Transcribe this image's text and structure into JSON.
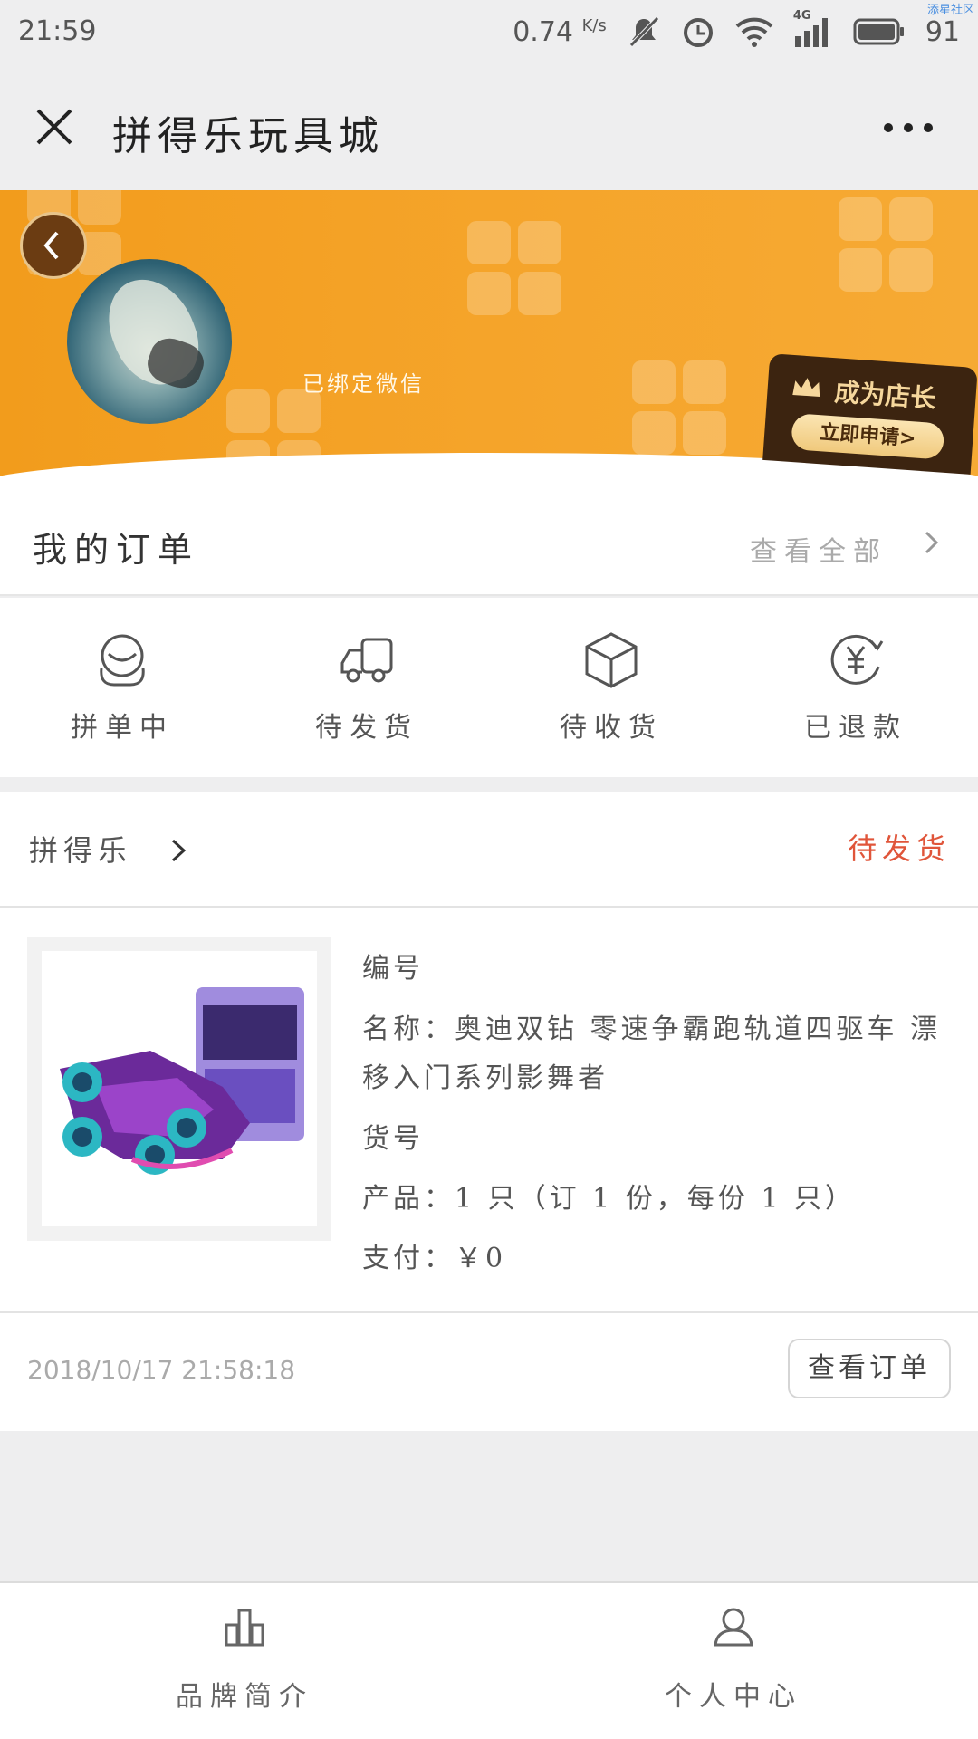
{
  "status_bar": {
    "time": "21:59",
    "net_speed": "0.74",
    "net_unit": "K/s",
    "network": "4G",
    "battery": "91",
    "watermark": "添星社区"
  },
  "nav": {
    "title": "拼得乐玩具城"
  },
  "profile": {
    "bound_text": "已绑定微信",
    "shop_owner_title": "成为店长",
    "shop_owner_apply": "立即申请>"
  },
  "orders": {
    "title": "我的订单",
    "view_all": "查看全部",
    "categories": [
      {
        "label": "拼单中",
        "icon": "group-person-icon"
      },
      {
        "label": "待发货",
        "icon": "delivery-truck-icon"
      },
      {
        "label": "待收货",
        "icon": "package-box-icon"
      },
      {
        "label": "已退款",
        "icon": "yen-refund-icon"
      }
    ]
  },
  "order": {
    "shop_name": "拼得乐",
    "status": "待发货",
    "number_label": "编号",
    "name_text": "名称：奥迪双钻 零速争霸跑轨道四驱车 漂移入门系列影舞者",
    "sku_label": "货号",
    "product_text": "产品：1 只（订 1 份，每份 1 只）",
    "payment_text": "支付：￥0",
    "date": "2018/10/17  21:58:18",
    "view_button": "查看订单"
  },
  "tabbar": {
    "items": [
      {
        "label": "品牌简介",
        "icon": "brand-chart-icon"
      },
      {
        "label": "个人中心",
        "icon": "person-icon"
      }
    ]
  }
}
